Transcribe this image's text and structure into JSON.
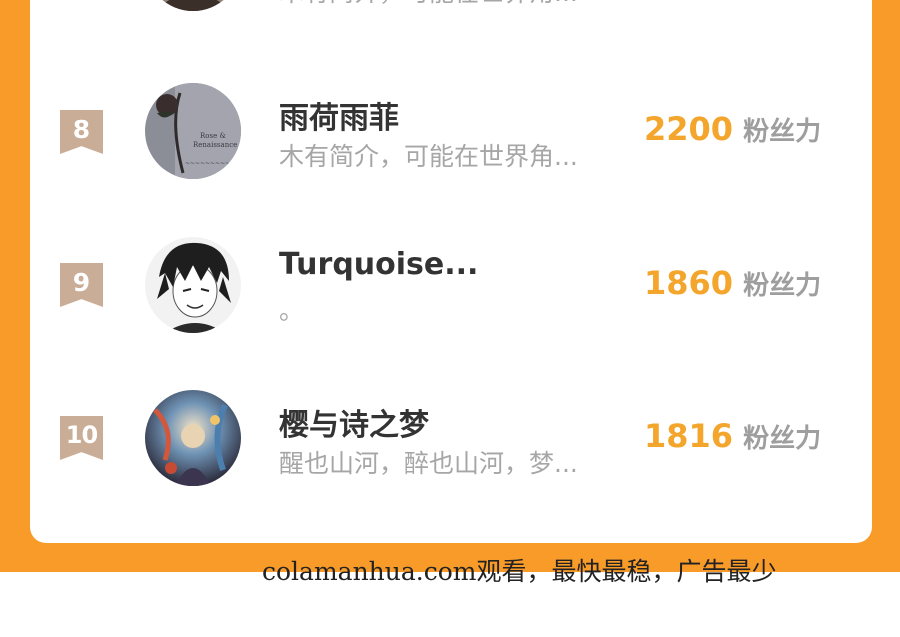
{
  "ranking": {
    "partial_top_row": {
      "bio": "木有简介，可能在世界角..."
    },
    "rows": [
      {
        "rank": "8",
        "name": "雨荷雨菲",
        "bio": "木有简介，可能在世界角...",
        "fans_value": "2200",
        "fans_label": "粉丝力",
        "avatar_icon": "rose-avatar"
      },
      {
        "rank": "9",
        "name": "Turquoise...",
        "bio": "。",
        "fans_value": "1860",
        "fans_label": "粉丝力",
        "avatar_icon": "anime-boy-avatar"
      },
      {
        "rank": "10",
        "name": "樱与诗之梦",
        "bio": "醒也山河，醉也山河，梦...",
        "fans_value": "1816",
        "fans_label": "粉丝力",
        "avatar_icon": "fantasy-art-avatar"
      }
    ]
  },
  "footer": {
    "watermark": "colamanhua.com观看，最快最稳，广告最少"
  },
  "colors": {
    "frame_orange": "#f99b28",
    "fans_value": "#f3a52c",
    "rank_badge": "#c9ad97"
  }
}
